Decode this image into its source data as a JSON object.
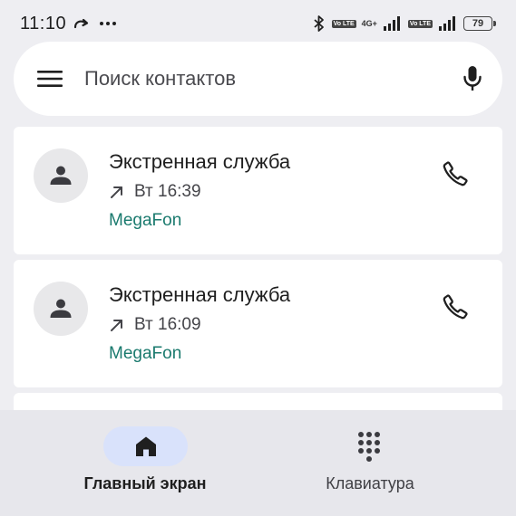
{
  "status_bar": {
    "time": "11:10",
    "network_tag_1": "Vo LTE",
    "network_4g": "4G+",
    "network_tag_2": "Vo LTE",
    "battery": "79",
    "icons": [
      "call-forward-icon",
      "more-icon",
      "bluetooth-icon",
      "signal-icon",
      "battery-icon"
    ]
  },
  "search": {
    "placeholder": "Поиск контактов",
    "icons": [
      "menu-icon",
      "mic-icon"
    ]
  },
  "calls": [
    {
      "name": "Экстренная служба",
      "direction": "outgoing",
      "time": "Вт 16:39",
      "carrier": "MegaFon"
    },
    {
      "name": "Экстренная служба",
      "direction": "outgoing",
      "time": "Вт 16:09",
      "carrier": "MegaFon"
    }
  ],
  "bottom_nav": {
    "home_label": "Главный экран",
    "keypad_label": "Клавиатура",
    "active": "home"
  },
  "colors": {
    "background": "#eeeef2",
    "carrier": "#1a7a6e",
    "active_pill": "#d9e2fb"
  }
}
